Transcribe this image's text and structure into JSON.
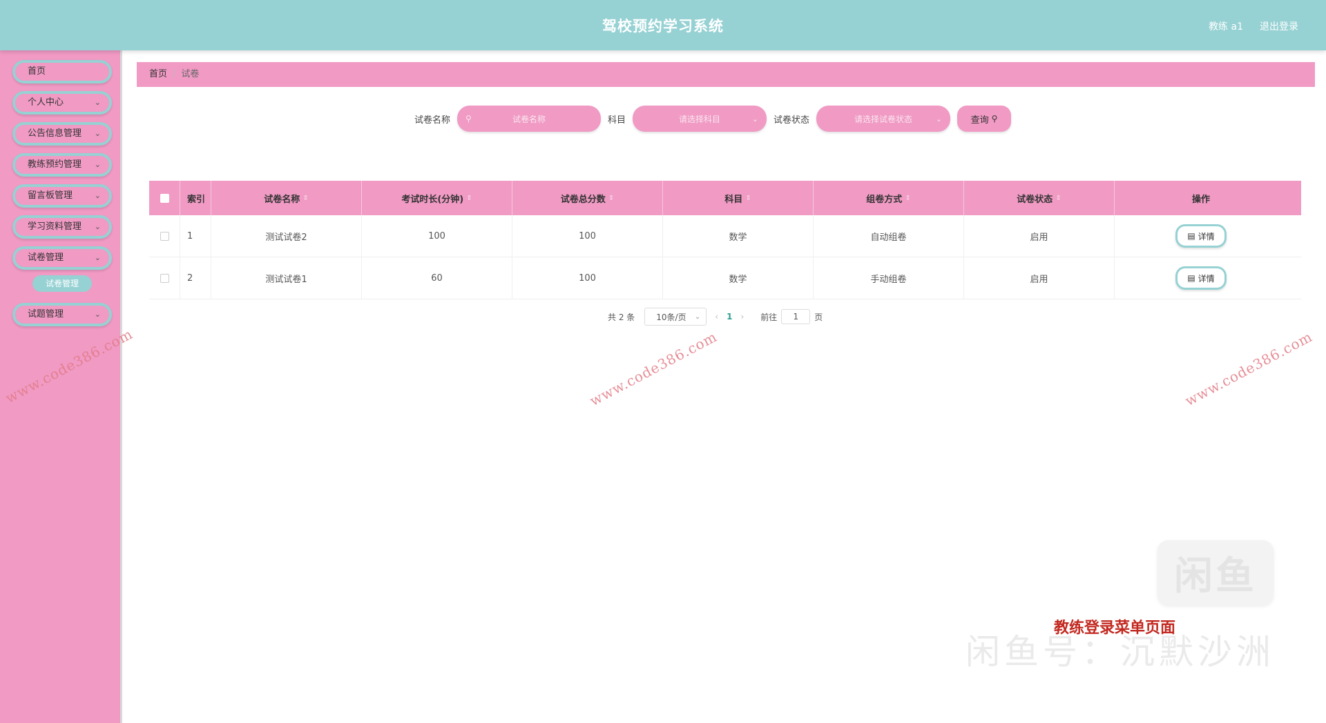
{
  "header": {
    "title": "驾校预约学习系统",
    "user": "教练 a1",
    "logout": "退出登录"
  },
  "sidebar": {
    "items": [
      {
        "label": "首页",
        "chevron": false
      },
      {
        "label": "个人中心",
        "chevron": true
      },
      {
        "label": "公告信息管理",
        "chevron": true
      },
      {
        "label": "教练预约管理",
        "chevron": true
      },
      {
        "label": "留言板管理",
        "chevron": true
      },
      {
        "label": "学习资料管理",
        "chevron": true
      },
      {
        "label": "试卷管理",
        "chevron": true
      },
      {
        "label": "试题管理",
        "chevron": true
      }
    ],
    "submenu_label": "试卷管理"
  },
  "breadcrumb": {
    "home": "首页",
    "separator": "/",
    "current": "试卷"
  },
  "search": {
    "name_label": "试卷名称",
    "name_placeholder": "试卷名称",
    "subject_label": "科目",
    "subject_placeholder": "请选择科目",
    "status_label": "试卷状态",
    "status_placeholder": "请选择试卷状态",
    "query_label": "查询"
  },
  "table": {
    "headers": {
      "index": "索引",
      "name": "试卷名称",
      "duration": "考试时长(分钟)",
      "score": "试卷总分数",
      "subject": "科目",
      "mode": "组卷方式",
      "status": "试卷状态",
      "op": "操作"
    },
    "rows": [
      {
        "index": "1",
        "name": "测试试卷2",
        "duration": "100",
        "score": "100",
        "subject": "数学",
        "mode": "自动组卷",
        "status": "启用",
        "op": "详情"
      },
      {
        "index": "2",
        "name": "测试试卷1",
        "duration": "60",
        "score": "100",
        "subject": "数学",
        "mode": "手动组卷",
        "status": "启用",
        "op": "详情"
      }
    ]
  },
  "pagination": {
    "total": "共 2 条",
    "page_size": "10条/页",
    "current_page": "1",
    "goto_prefix": "前往",
    "goto_value": "1",
    "goto_suffix": "页"
  },
  "watermark": {
    "text": "www.code386.com"
  },
  "overlay": {
    "logo_text": "闲鱼",
    "caption": "教练登录菜单页面",
    "ghost_text": "闲鱼号：沉默沙洲"
  },
  "icons": {
    "search": "search-icon",
    "chevron": "chevron-down-icon",
    "detail": "document-icon"
  },
  "colors": {
    "header": "#96d1d3",
    "pink": "#f09ac4",
    "accent": "#96d1d3",
    "watermark": "#e27b86",
    "caption": "#c2281f"
  }
}
